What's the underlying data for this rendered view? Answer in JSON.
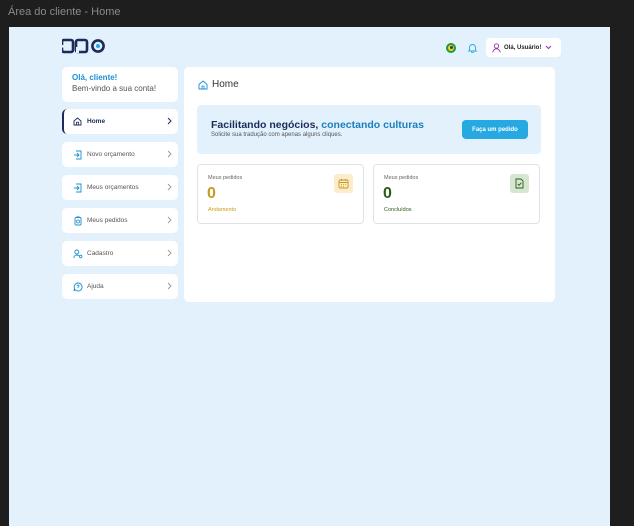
{
  "frame_title": "Área do cliente - Home",
  "brand": {
    "logo_text": "BPO"
  },
  "header": {
    "user_label": "Olá, Usuário!",
    "icons": [
      "brazil-flag-icon",
      "bell-icon",
      "user-icon",
      "chevron-down-icon"
    ]
  },
  "sidebar": {
    "greeting_title": "Olá, cliente!",
    "greeting_subtitle": "Bem-vindo a sua conta!",
    "items": [
      {
        "label": "Home",
        "icon": "home-icon",
        "active": true
      },
      {
        "label": "Novo orçamento",
        "icon": "new-quote-icon",
        "active": false
      },
      {
        "label": "Meus orçamentos",
        "icon": "quotes-icon",
        "active": false
      },
      {
        "label": "Meus pedidos",
        "icon": "orders-icon",
        "active": false
      },
      {
        "label": "Cadastro",
        "icon": "user-settings-icon",
        "active": false
      },
      {
        "label": "Ajuda",
        "icon": "help-chat-icon",
        "active": false
      }
    ]
  },
  "main": {
    "title": "Home",
    "banner": {
      "title_part1": "Facilitando negócios,",
      "title_part2": "conectando culturas",
      "subtitle": "Solicite sua tradução com apenas alguns cliques.",
      "cta_label": "Faça um pedido"
    },
    "cards": [
      {
        "label": "Meus pedidos",
        "value": "0",
        "status": "Andamento",
        "icon": "calendar-icon",
        "color": "#c99a1a"
      },
      {
        "label": "Meus pedidos",
        "value": "0",
        "status": "Concluídos",
        "icon": "document-check-icon",
        "color": "#2d5a1f"
      }
    ]
  },
  "colors": {
    "canvas_bg": "#e3f1fc",
    "accent": "#26a8e0",
    "navy": "#1c2b5a"
  }
}
